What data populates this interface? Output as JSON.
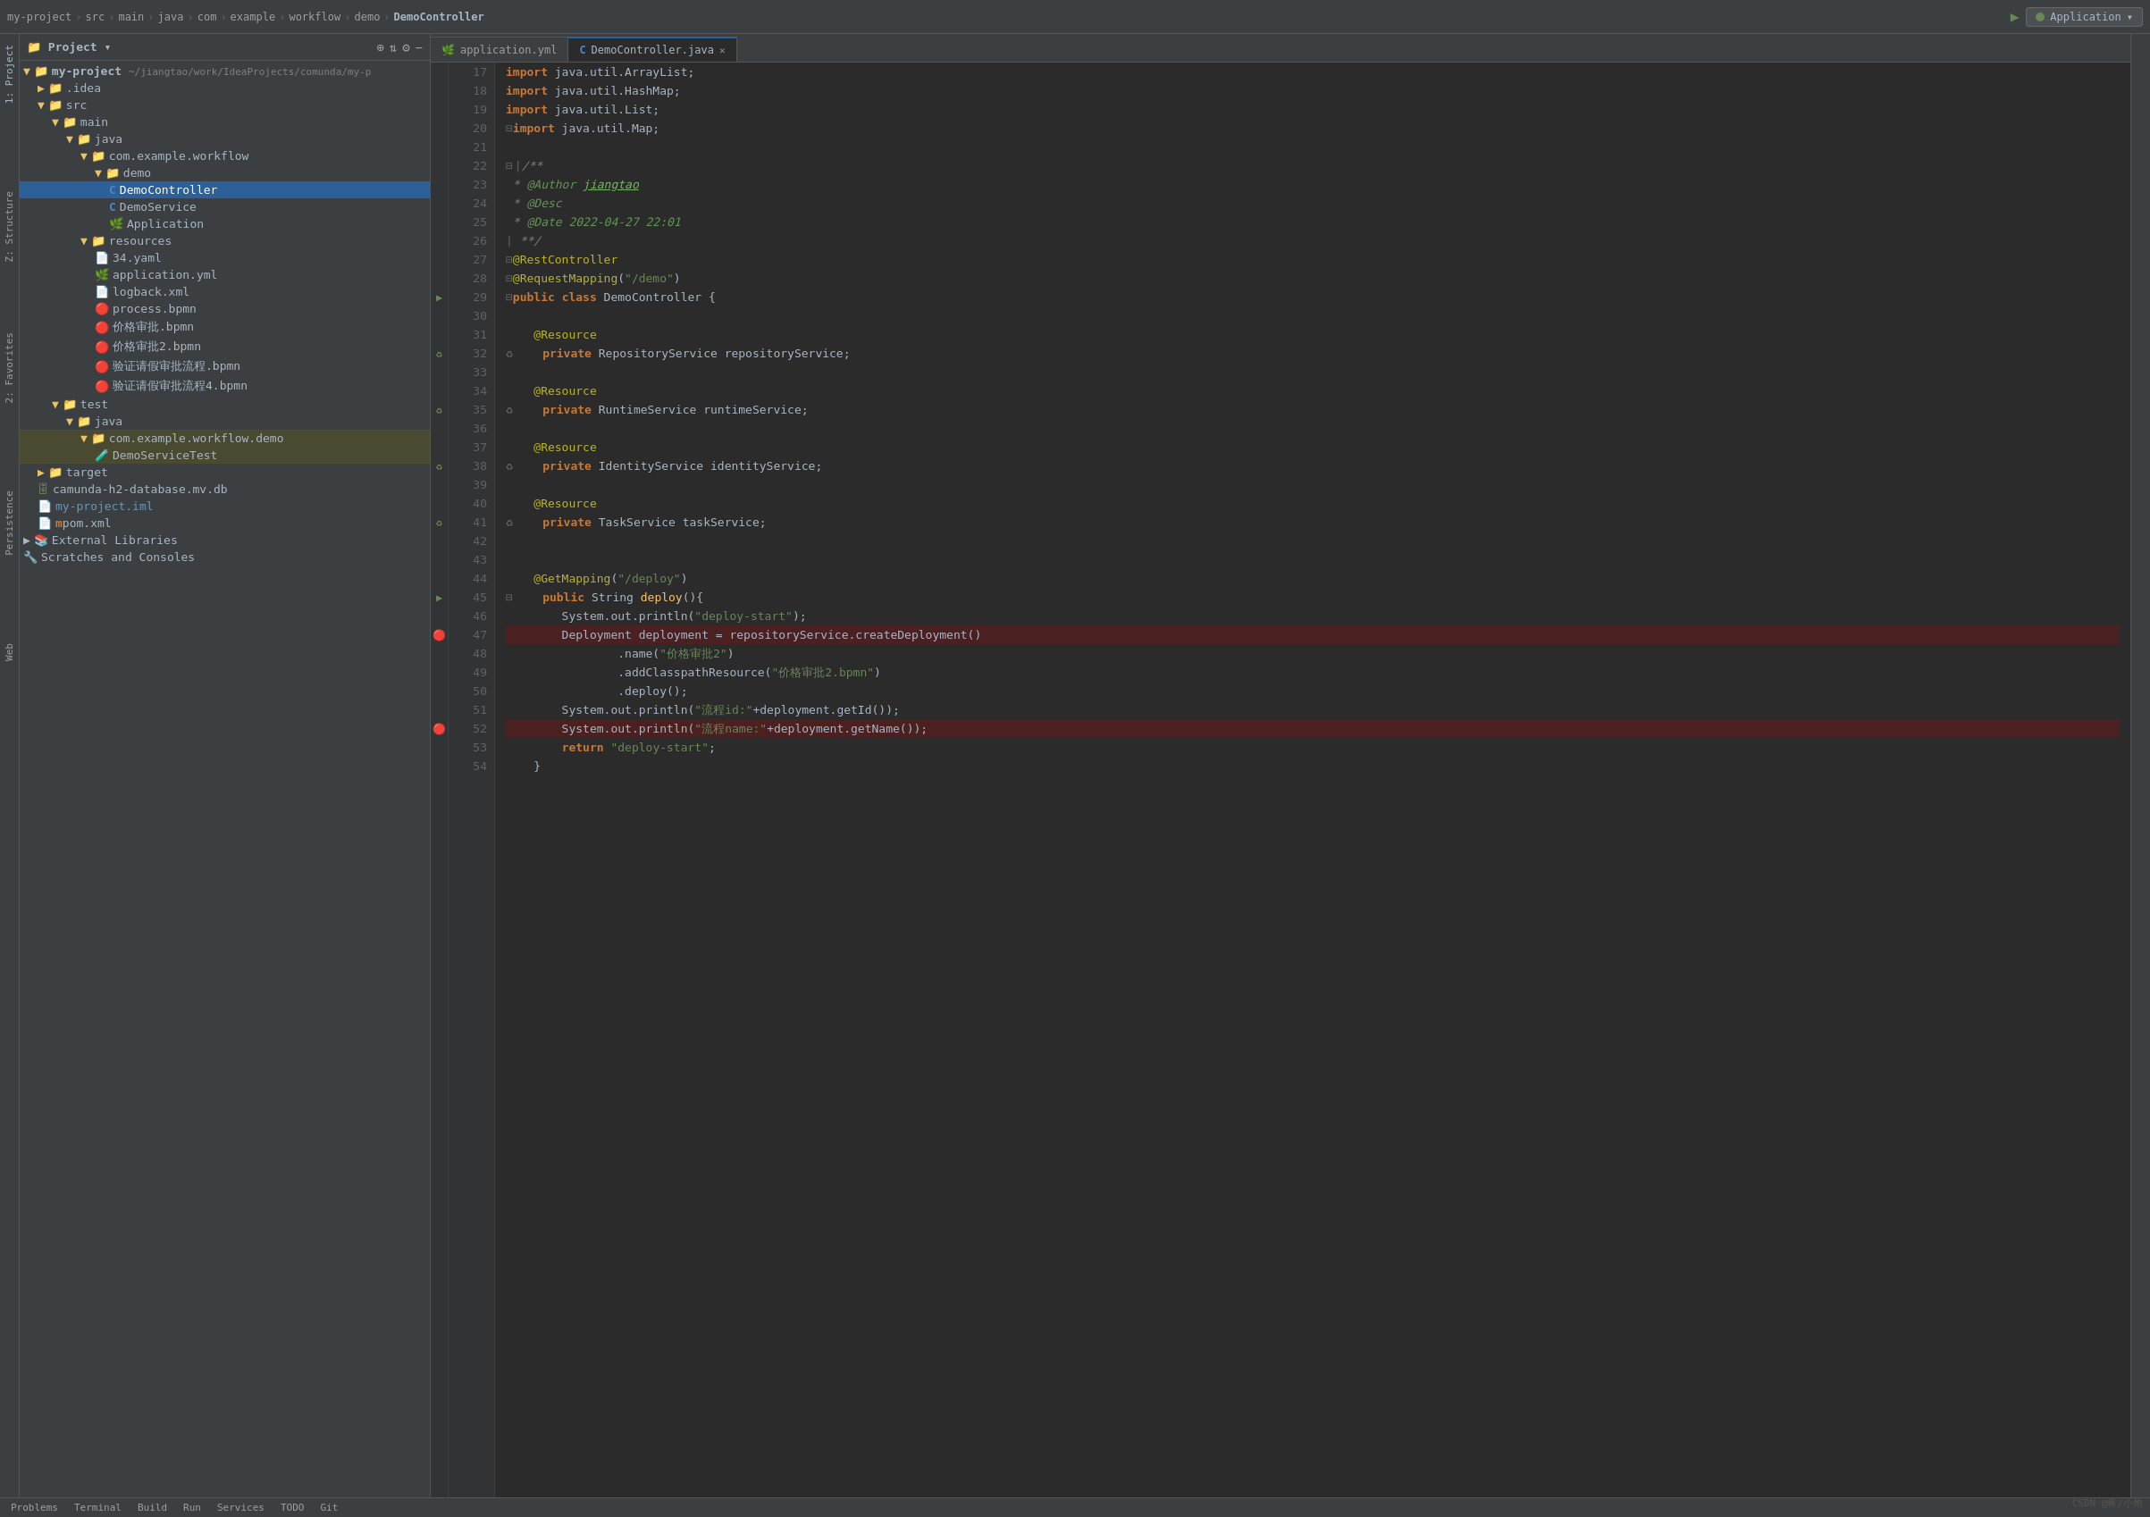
{
  "topBar": {
    "breadcrumb": [
      "my-project",
      "src",
      "main",
      "java",
      "com",
      "example",
      "workflow",
      "demo",
      "DemoController"
    ],
    "appConfig": "Application",
    "arrowIcon": "▶",
    "settingsIcon": "⚙"
  },
  "sidebar": {
    "title": "Project",
    "leftTabs": [
      {
        "label": "1: Project",
        "active": true
      },
      {
        "label": "2: Favorites"
      },
      {
        "label": "Persistence"
      },
      {
        "label": "Web"
      }
    ],
    "rightTabs": [
      {
        "label": "Z: Structure"
      },
      {
        "label": "2: Favorites"
      }
    ],
    "tree": [
      {
        "level": 0,
        "icon": "▼",
        "iconType": "folder",
        "name": "my-project",
        "suffix": " ~/jiangtao/work/IdeaProjects/comunda/my-p",
        "selected": false
      },
      {
        "level": 1,
        "icon": "▶",
        "iconType": "folder",
        "name": ".idea",
        "selected": false
      },
      {
        "level": 1,
        "icon": "▼",
        "iconType": "folder",
        "name": "src",
        "selected": false
      },
      {
        "level": 2,
        "icon": "▼",
        "iconType": "folder",
        "name": "main",
        "selected": false
      },
      {
        "level": 3,
        "icon": "▼",
        "iconType": "folder",
        "name": "java",
        "selected": false
      },
      {
        "level": 4,
        "icon": "▼",
        "iconType": "folder",
        "name": "com.example.workflow",
        "selected": false
      },
      {
        "level": 5,
        "icon": "▼",
        "iconType": "folder",
        "name": "demo",
        "selected": false
      },
      {
        "level": 6,
        "icon": "C",
        "iconType": "java",
        "name": "DemoController",
        "selected": true
      },
      {
        "level": 6,
        "icon": "C",
        "iconType": "java",
        "name": "DemoService",
        "selected": false
      },
      {
        "level": 6,
        "icon": "A",
        "iconType": "app",
        "name": "Application",
        "selected": false
      },
      {
        "level": 4,
        "icon": "▼",
        "iconType": "folder",
        "name": "resources",
        "selected": false
      },
      {
        "level": 5,
        "icon": "Y",
        "iconType": "yaml",
        "name": "34.yaml",
        "selected": false
      },
      {
        "level": 5,
        "icon": "Y",
        "iconType": "yaml",
        "name": "application.yml",
        "selected": false
      },
      {
        "level": 5,
        "icon": "X",
        "iconType": "xml",
        "name": "logback.xml",
        "selected": false
      },
      {
        "level": 5,
        "icon": "B",
        "iconType": "bpmn",
        "name": "process.bpmn",
        "selected": false
      },
      {
        "level": 5,
        "icon": "B",
        "iconType": "bpmn",
        "name": "价格审批.bpmn",
        "selected": false
      },
      {
        "level": 5,
        "icon": "B",
        "iconType": "bpmn",
        "name": "价格审批2.bpmn",
        "selected": false
      },
      {
        "level": 5,
        "icon": "B",
        "iconType": "bpmn",
        "name": "验证请假审批流程.bpmn",
        "selected": false
      },
      {
        "level": 5,
        "icon": "B",
        "iconType": "bpmn",
        "name": "验证请假审批流程4.bpmn",
        "selected": false
      },
      {
        "level": 2,
        "icon": "▼",
        "iconType": "folder",
        "name": "test",
        "selected": false
      },
      {
        "level": 3,
        "icon": "▼",
        "iconType": "folder",
        "name": "java",
        "selected": false
      },
      {
        "level": 4,
        "icon": "▼",
        "iconType": "folder",
        "name": "com.example.workflow.demo",
        "selected": false
      },
      {
        "level": 5,
        "icon": "T",
        "iconType": "java",
        "name": "DemoServiceTest",
        "selected": false,
        "test": true
      },
      {
        "level": 1,
        "icon": "▶",
        "iconType": "folder",
        "name": "target",
        "selected": false
      },
      {
        "level": 1,
        "icon": "D",
        "iconType": "db",
        "name": "camunda-h2-database.mv.db",
        "selected": false
      },
      {
        "level": 1,
        "icon": "I",
        "iconType": "iml",
        "name": "my-project.iml",
        "selected": false
      },
      {
        "level": 1,
        "icon": "P",
        "iconType": "pom",
        "name": "pom.xml",
        "selected": false
      },
      {
        "level": 0,
        "icon": "▶",
        "iconType": "folder",
        "name": "External Libraries",
        "selected": false
      },
      {
        "level": 0,
        "icon": "S",
        "iconType": "scratch",
        "name": "Scratches and Consoles",
        "selected": false
      }
    ]
  },
  "editor": {
    "tabs": [
      {
        "name": "application.yml",
        "active": false,
        "icon": "Y"
      },
      {
        "name": "DemoController.java",
        "active": true,
        "icon": "C",
        "closeable": true
      }
    ],
    "lines": [
      {
        "num": 17,
        "gutter": "",
        "content": [
          {
            "type": "kw",
            "text": "import"
          },
          {
            "type": "plain",
            "text": " java.util.ArrayList;"
          }
        ]
      },
      {
        "num": 18,
        "gutter": "",
        "content": [
          {
            "type": "kw",
            "text": "import"
          },
          {
            "type": "plain",
            "text": " java.util.HashMap;"
          }
        ]
      },
      {
        "num": 19,
        "gutter": "",
        "content": [
          {
            "type": "kw",
            "text": "import"
          },
          {
            "type": "plain",
            "text": " java.util.List;"
          }
        ]
      },
      {
        "num": 20,
        "gutter": "fold",
        "content": [
          {
            "type": "kw",
            "text": "import"
          },
          {
            "type": "plain",
            "text": " java.util.Map;"
          }
        ]
      },
      {
        "num": 21,
        "gutter": "",
        "content": []
      },
      {
        "num": 22,
        "gutter": "fold",
        "content": [
          {
            "type": "comment",
            "text": "/**"
          }
        ]
      },
      {
        "num": 23,
        "gutter": "",
        "content": [
          {
            "type": "comment",
            "text": " * "
          },
          {
            "type": "javadoc-tag",
            "text": "@Author"
          },
          {
            "type": "plain",
            "text": " "
          },
          {
            "type": "javadoc-val",
            "text": "jiangtao"
          }
        ]
      },
      {
        "num": 24,
        "gutter": "",
        "content": [
          {
            "type": "comment",
            "text": " * "
          },
          {
            "type": "javadoc-tag",
            "text": "@Desc"
          }
        ]
      },
      {
        "num": 25,
        "gutter": "",
        "content": [
          {
            "type": "comment",
            "text": " * "
          },
          {
            "type": "javadoc-tag",
            "text": "@Date"
          },
          {
            "type": "plain",
            "text": " "
          },
          {
            "type": "javadoc-date",
            "text": "2022-04-27 22:01"
          }
        ]
      },
      {
        "num": 26,
        "gutter": "",
        "content": [
          {
            "type": "comment",
            "text": " **/"
          }
        ]
      },
      {
        "num": 27,
        "gutter": "",
        "content": [
          {
            "type": "annotation",
            "text": "@RestController"
          }
        ]
      },
      {
        "num": 28,
        "gutter": "",
        "content": [
          {
            "type": "annotation",
            "text": "@RequestMapping"
          },
          {
            "type": "plain",
            "text": "("
          },
          {
            "type": "str",
            "text": "\"/demo\""
          },
          {
            "type": "plain",
            "text": ")"
          }
        ]
      },
      {
        "num": 29,
        "gutter": "run",
        "content": [
          {
            "type": "kw",
            "text": "public"
          },
          {
            "type": "plain",
            "text": " "
          },
          {
            "type": "kw",
            "text": "class"
          },
          {
            "type": "plain",
            "text": " DemoController {"
          }
        ]
      },
      {
        "num": 30,
        "gutter": "",
        "content": []
      },
      {
        "num": 31,
        "gutter": "",
        "content": [
          {
            "type": "plain",
            "text": "    "
          },
          {
            "type": "annotation",
            "text": "@Resource"
          }
        ]
      },
      {
        "num": 32,
        "gutter": "warn",
        "content": [
          {
            "type": "plain",
            "text": "    "
          },
          {
            "type": "kw",
            "text": "private"
          },
          {
            "type": "plain",
            "text": " RepositoryService repositoryService;"
          }
        ]
      },
      {
        "num": 33,
        "gutter": "",
        "content": []
      },
      {
        "num": 34,
        "gutter": "",
        "content": [
          {
            "type": "plain",
            "text": "    "
          },
          {
            "type": "annotation",
            "text": "@Resource"
          }
        ]
      },
      {
        "num": 35,
        "gutter": "warn",
        "content": [
          {
            "type": "plain",
            "text": "    "
          },
          {
            "type": "kw",
            "text": "private"
          },
          {
            "type": "plain",
            "text": " RuntimeService runtimeService;"
          }
        ]
      },
      {
        "num": 36,
        "gutter": "",
        "content": []
      },
      {
        "num": 37,
        "gutter": "",
        "content": [
          {
            "type": "plain",
            "text": "    "
          },
          {
            "type": "annotation",
            "text": "@Resource"
          }
        ]
      },
      {
        "num": 38,
        "gutter": "warn",
        "content": [
          {
            "type": "plain",
            "text": "    "
          },
          {
            "type": "kw",
            "text": "private"
          },
          {
            "type": "plain",
            "text": " IdentityService identityService;"
          }
        ]
      },
      {
        "num": 39,
        "gutter": "",
        "content": []
      },
      {
        "num": 40,
        "gutter": "",
        "content": [
          {
            "type": "plain",
            "text": "    "
          },
          {
            "type": "annotation",
            "text": "@Resource"
          }
        ]
      },
      {
        "num": 41,
        "gutter": "warn",
        "content": [
          {
            "type": "plain",
            "text": "    "
          },
          {
            "type": "kw",
            "text": "private"
          },
          {
            "type": "plain",
            "text": " TaskService taskService;"
          }
        ]
      },
      {
        "num": 42,
        "gutter": "",
        "content": []
      },
      {
        "num": 43,
        "gutter": "",
        "content": []
      },
      {
        "num": 44,
        "gutter": "",
        "content": [
          {
            "type": "plain",
            "text": "    "
          },
          {
            "type": "annotation",
            "text": "@GetMapping"
          },
          {
            "type": "plain",
            "text": "("
          },
          {
            "type": "str",
            "text": "\"/deploy\""
          },
          {
            "type": "plain",
            "text": ")"
          }
        ]
      },
      {
        "num": 45,
        "gutter": "run",
        "content": [
          {
            "type": "plain",
            "text": "    "
          },
          {
            "type": "kw",
            "text": "public"
          },
          {
            "type": "plain",
            "text": " String "
          },
          {
            "type": "method",
            "text": "deploy"
          },
          {
            "type": "plain",
            "text": "(){"
          }
        ]
      },
      {
        "num": 46,
        "gutter": "",
        "content": [
          {
            "type": "plain",
            "text": "        System.out.println("
          },
          {
            "type": "str",
            "text": "\"deploy-start\""
          },
          {
            "type": "plain",
            "text": ");"
          }
        ]
      },
      {
        "num": 47,
        "gutter": "err",
        "content": [
          {
            "type": "plain",
            "text": "        Deployment deployment = repositoryService.createDeployment()"
          }
        ],
        "error": true
      },
      {
        "num": 48,
        "gutter": "",
        "content": [
          {
            "type": "plain",
            "text": "                .name("
          },
          {
            "type": "str",
            "text": "\"价格审批2\""
          },
          {
            "type": "plain",
            "text": ")"
          }
        ]
      },
      {
        "num": 49,
        "gutter": "",
        "content": [
          {
            "type": "plain",
            "text": "                .addClasspathResource("
          },
          {
            "type": "str",
            "text": "\"价格审批2.bpmn\""
          },
          {
            "type": "plain",
            "text": ")"
          }
        ]
      },
      {
        "num": 50,
        "gutter": "",
        "content": [
          {
            "type": "plain",
            "text": "                .deploy();"
          }
        ]
      },
      {
        "num": 51,
        "gutter": "",
        "content": [
          {
            "type": "plain",
            "text": "        System.out.println("
          },
          {
            "type": "str",
            "text": "\"流程id:\""
          },
          {
            "type": "plain",
            "text": "+deployment.getId());"
          }
        ]
      },
      {
        "num": 52,
        "gutter": "err",
        "content": [
          {
            "type": "plain",
            "text": "        System.out.println("
          },
          {
            "type": "str",
            "text": "\"流程name:\""
          },
          {
            "type": "plain",
            "text": "+deployment.getName());"
          }
        ],
        "error": true
      },
      {
        "num": 53,
        "gutter": "",
        "content": [
          {
            "type": "plain",
            "text": "        "
          },
          {
            "type": "kw",
            "text": "return"
          },
          {
            "type": "plain",
            "text": " "
          },
          {
            "type": "str",
            "text": "\"deploy-start\""
          },
          {
            "type": "plain",
            "text": ";"
          }
        ]
      },
      {
        "num": 54,
        "gutter": "",
        "content": [
          {
            "type": "plain",
            "text": "    }"
          }
        ]
      }
    ]
  },
  "watermark": "CSDN @蒋/小炮"
}
